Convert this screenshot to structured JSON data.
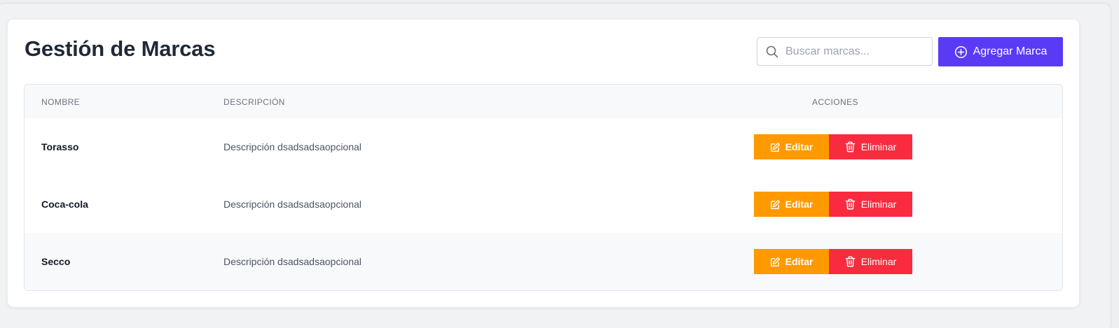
{
  "page": {
    "title": "Gestión de Marcas"
  },
  "search": {
    "placeholder": "Buscar marcas...",
    "value": "",
    "icon": "search-icon"
  },
  "add_button": {
    "label": "Agregar Marca",
    "icon": "plus-circle-icon",
    "color": "#5a3af5"
  },
  "table": {
    "headers": {
      "name": "NOMBRE",
      "description": "DESCRIPCIÓN",
      "actions": "ACCIONES"
    },
    "rows": [
      {
        "name": "Torasso",
        "description": "Descripción dsadsadsaopcional"
      },
      {
        "name": "Coca-cola",
        "description": "Descripción dsadsadsaopcional"
      },
      {
        "name": "Secco",
        "description": "Descripción dsadsadsaopcional"
      }
    ],
    "edit_label": "Editar",
    "delete_label": "Eliminar",
    "edit_color": "#ff9900",
    "delete_color": "#fa2b3f"
  }
}
